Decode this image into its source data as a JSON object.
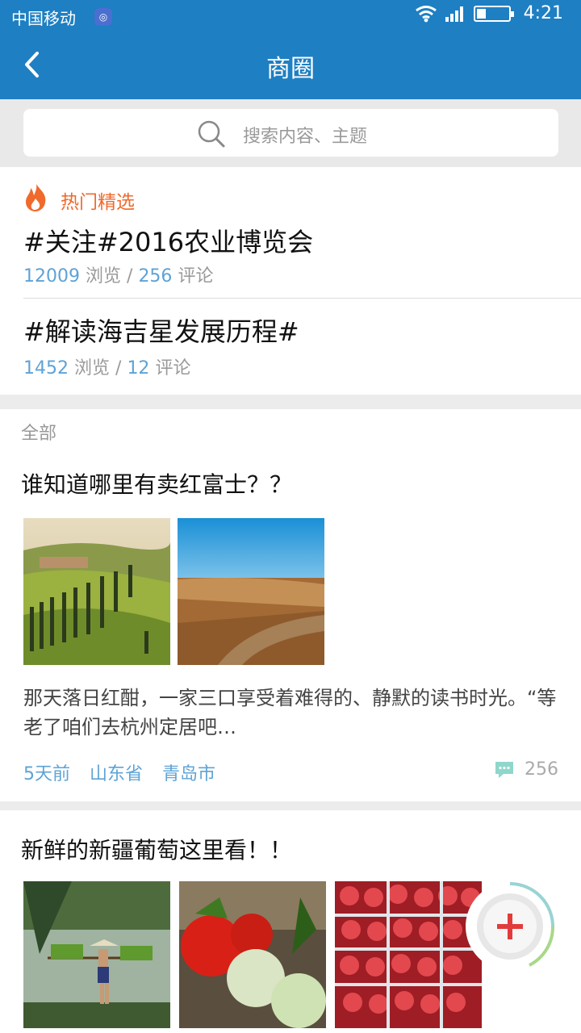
{
  "status_bar": {
    "carrier": "中国移动",
    "time": "4:21",
    "battery_level": 0.3
  },
  "nav": {
    "title": "商圈"
  },
  "search": {
    "placeholder": "搜索内容、主题"
  },
  "hot": {
    "label": "热门精选",
    "topics": [
      {
        "title": "#关注#2016农业博览会",
        "views": "12009",
        "views_label": "浏览",
        "sep": "/",
        "comments": "256",
        "comments_label": "评论"
      },
      {
        "title": "#解读海吉星发展历程#",
        "views": "1452",
        "views_label": "浏览",
        "sep": "/",
        "comments": "12",
        "comments_label": "评论"
      }
    ]
  },
  "all_section": {
    "label": "全部"
  },
  "posts": [
    {
      "title": "谁知道哪里有卖红富士？？",
      "excerpt": "那天落日红酣，一家三口享受着难得的、静默的读书时光。“等老了咱们去杭州定居吧…",
      "time": "5天前",
      "province": "山东省",
      "city": "青岛市",
      "comments": "256"
    },
    {
      "title": "新鲜的新疆葡萄这里看！！"
    }
  ],
  "colors": {
    "primary": "#1e7fc3",
    "hot": "#ef6a2c",
    "link": "#5ea3d6",
    "fab_plus": "#e23b3b"
  }
}
